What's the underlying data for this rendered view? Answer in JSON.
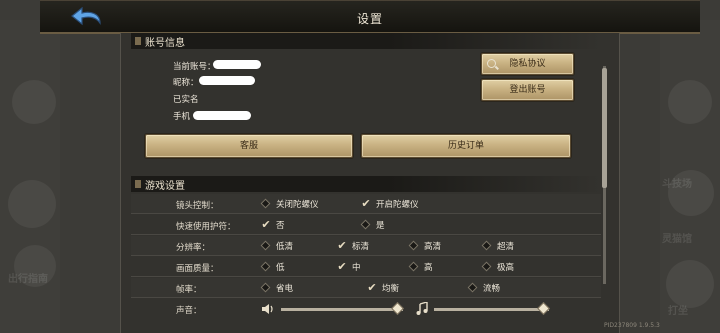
{
  "header": {
    "title": "设置"
  },
  "account": {
    "section_title": "账号信息",
    "current_account_label": "当前账号：",
    "nickname_label": "昵称：",
    "realname_label": "已实名",
    "phone_label": "手机",
    "privacy_button": "隐私协议",
    "logout_button": "登出账号",
    "service_button": "客服",
    "orders_button": "历史订单"
  },
  "game": {
    "section_title": "游戏设置",
    "rows": [
      {
        "label": "镜头控制：",
        "options": [
          {
            "text": "关闭陀螺仪",
            "checked": false
          },
          {
            "text": "开启陀螺仪",
            "checked": true
          }
        ]
      },
      {
        "label": "快速使用护符：",
        "options": [
          {
            "text": "否",
            "checked": true
          },
          {
            "text": "是",
            "checked": false
          }
        ]
      },
      {
        "label": "分辨率：",
        "options": [
          {
            "text": "低清",
            "checked": false
          },
          {
            "text": "标清",
            "checked": true
          },
          {
            "text": "高清",
            "checked": false
          },
          {
            "text": "超清",
            "checked": false
          }
        ]
      },
      {
        "label": "画面质量：",
        "options": [
          {
            "text": "低",
            "checked": false
          },
          {
            "text": "中",
            "checked": true
          },
          {
            "text": "高",
            "checked": false
          },
          {
            "text": "极高",
            "checked": false
          }
        ]
      },
      {
        "label": "帧率：",
        "options": [
          {
            "text": "省电",
            "checked": false
          },
          {
            "text": "均衡",
            "checked": true
          },
          {
            "text": "流畅",
            "checked": false
          }
        ]
      }
    ],
    "volume_label": "声音：",
    "sound_volume": 1.0,
    "music_volume": 1.0
  },
  "footer": {
    "version": "PID237809 1.9.5.3"
  },
  "background_text": [
    "斗技场",
    "灵猫馆",
    "出行指南",
    "打坐",
    "打坐"
  ],
  "colors": {
    "button_gold": "#c9b283",
    "panel": "#33322e",
    "header_bar": "#1b1a17"
  }
}
